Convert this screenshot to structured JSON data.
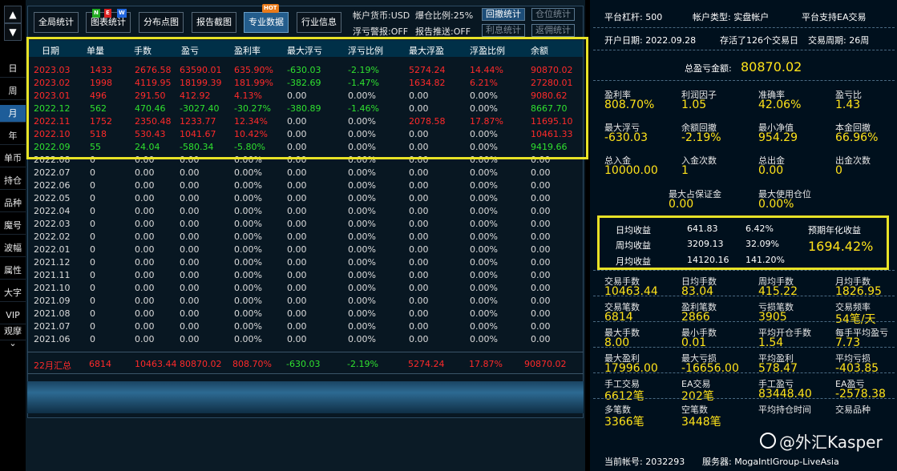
{
  "colors": {
    "up": "#ff2a2a",
    "down": "#2fe02f",
    "neutral": "#dcdcdc",
    "highlight": "#e8e226",
    "accent": "#ffe31a",
    "header_bg": "#003048"
  },
  "left": {
    "up_icon": "up-triangle-icon",
    "down_icon": "down-triangle-icon",
    "arrows": [
      "▲",
      "▼"
    ],
    "periods": [
      "日",
      "周",
      "月",
      "年"
    ],
    "period_selected": "月",
    "tabs": [
      "单币",
      "持仓",
      "品种",
      "魔号",
      "波幅",
      "属性",
      "大字",
      "VIP",
      "观摩"
    ],
    "more": "⌄"
  },
  "tabs": [
    "全局统计",
    "图表统计",
    "分布点图",
    "报告截图",
    "专业数据",
    "行业信息"
  ],
  "tab_selected": "专业数据",
  "badge_new": [
    "N",
    "E",
    "W"
  ],
  "badge_hot": "HOT",
  "info": {
    "currency": "帐户货币:USD",
    "burst": "爆仓比例:25%",
    "float_alert": "浮亏警报:OFF",
    "report_push": "报告推送:OFF"
  },
  "side_buttons": [
    "回撤统计",
    "仓位统计",
    "利息统计",
    "返佣统计"
  ],
  "table": {
    "headers": [
      "日期",
      "单量",
      "手数",
      "盈亏",
      "盈利率",
      "最大浮亏",
      "浮亏比例",
      "最大浮盈",
      "浮盈比例",
      "余额"
    ],
    "rows": [
      [
        "2023.03",
        "1433",
        "2676.58",
        "63590.01",
        "635.90%",
        "-630.03",
        "-2.19%",
        "5274.24",
        "14.44%",
        "90870.02"
      ],
      [
        "2023.02",
        "1998",
        "4119.95",
        "18199.39",
        "181.99%",
        "-382.69",
        "-1.47%",
        "1634.82",
        "6.21%",
        "27280.01"
      ],
      [
        "2023.01",
        "496",
        "291.50",
        "412.92",
        "4.13%",
        "0.00",
        "0.00%",
        "0.00",
        "0.00%",
        "9080.62"
      ],
      [
        "2022.12",
        "562",
        "470.46",
        "-3027.40",
        "-30.27%",
        "-380.89",
        "-1.46%",
        "0.00",
        "0.00%",
        "8667.70"
      ],
      [
        "2022.11",
        "1752",
        "2350.48",
        "1233.77",
        "12.34%",
        "0.00",
        "0.00%",
        "2078.58",
        "17.87%",
        "11695.10"
      ],
      [
        "2022.10",
        "518",
        "530.43",
        "1041.67",
        "10.42%",
        "0.00",
        "0.00%",
        "0.00",
        "0.00%",
        "10461.33"
      ],
      [
        "2022.09",
        "55",
        "24.04",
        "-580.34",
        "-5.80%",
        "0.00",
        "0.00%",
        "0.00",
        "0.00%",
        "9419.66"
      ],
      [
        "2022.08",
        "0",
        "0.00",
        "0.00",
        "0.00%",
        "0.00",
        "0.00%",
        "0.00",
        "0.00%",
        "0.00"
      ],
      [
        "2022.07",
        "0",
        "0.00",
        "0.00",
        "0.00%",
        "0.00",
        "0.00%",
        "0.00",
        "0.00%",
        "0.00"
      ],
      [
        "2022.06",
        "0",
        "0.00",
        "0.00",
        "0.00%",
        "0.00",
        "0.00%",
        "0.00",
        "0.00%",
        "0.00"
      ],
      [
        "2022.05",
        "0",
        "0.00",
        "0.00",
        "0.00%",
        "0.00",
        "0.00%",
        "0.00",
        "0.00%",
        "0.00"
      ],
      [
        "2022.04",
        "0",
        "0.00",
        "0.00",
        "0.00%",
        "0.00",
        "0.00%",
        "0.00",
        "0.00%",
        "0.00"
      ],
      [
        "2022.03",
        "0",
        "0.00",
        "0.00",
        "0.00%",
        "0.00",
        "0.00%",
        "0.00",
        "0.00%",
        "0.00"
      ],
      [
        "2022.02",
        "0",
        "0.00",
        "0.00",
        "0.00%",
        "0.00",
        "0.00%",
        "0.00",
        "0.00%",
        "0.00"
      ],
      [
        "2022.01",
        "0",
        "0.00",
        "0.00",
        "0.00%",
        "0.00",
        "0.00%",
        "0.00",
        "0.00%",
        "0.00"
      ],
      [
        "2021.12",
        "0",
        "0.00",
        "0.00",
        "0.00%",
        "0.00",
        "0.00%",
        "0.00",
        "0.00%",
        "0.00"
      ],
      [
        "2021.11",
        "0",
        "0.00",
        "0.00",
        "0.00%",
        "0.00",
        "0.00%",
        "0.00",
        "0.00%",
        "0.00"
      ],
      [
        "2021.10",
        "0",
        "0.00",
        "0.00",
        "0.00%",
        "0.00",
        "0.00%",
        "0.00",
        "0.00%",
        "0.00"
      ],
      [
        "2021.09",
        "0",
        "0.00",
        "0.00",
        "0.00%",
        "0.00",
        "0.00%",
        "0.00",
        "0.00%",
        "0.00"
      ],
      [
        "2021.08",
        "0",
        "0.00",
        "0.00",
        "0.00%",
        "0.00",
        "0.00%",
        "0.00",
        "0.00%",
        "0.00"
      ],
      [
        "2021.07",
        "0",
        "0.00",
        "0.00",
        "0.00%",
        "0.00",
        "0.00%",
        "0.00",
        "0.00%",
        "0.00"
      ],
      [
        "2021.06",
        "0",
        "0.00",
        "0.00",
        "0.00%",
        "0.00",
        "0.00%",
        "0.00",
        "0.00%",
        "0.00"
      ]
    ],
    "summary": [
      "22月汇总",
      "6814",
      "10463.44",
      "80870.02",
      "808.70%",
      "-630.03",
      "-2.19%",
      "5274.24",
      "17.87%",
      "90870.02"
    ]
  },
  "right": {
    "leverage": "平台杠杆: 500",
    "account_type": "帐户类型: 实盘帐户",
    "ea_support": "平台支持EA交易",
    "open_date": "开户日期: 2022.09.28",
    "survived": "存活了126个交易日",
    "trade_period": "交易周期: 26周",
    "total_pnl_label": "总盈亏金额:",
    "total_pnl": "80870.02",
    "stats": [
      {
        "label": "盈利率",
        "value": "808.70%"
      },
      {
        "label": "利润因子",
        "value": "1.05"
      },
      {
        "label": "准确率",
        "value": "42.06%"
      },
      {
        "label": "盈亏比",
        "value": "1.43"
      },
      {
        "label": "最大浮亏",
        "value": "-630.03"
      },
      {
        "label": "余额回撤",
        "value": "-2.19%"
      },
      {
        "label": "最小净值",
        "value": "954.29"
      },
      {
        "label": "本金回撤",
        "value": "66.96%"
      },
      {
        "label": "总入金",
        "value": "10000.00"
      },
      {
        "label": "入金次数",
        "value": "1"
      },
      {
        "label": "总出金",
        "value": "0.00"
      },
      {
        "label": "出金次数",
        "value": "0"
      }
    ],
    "margin": [
      {
        "label": "最大占保证金",
        "value": "0.00"
      },
      {
        "label": "最大使用仓位",
        "value": "0.00%"
      }
    ],
    "income": {
      "rows": [
        [
          "日均收益",
          "641.83",
          "6.42%"
        ],
        [
          "周均收益",
          "3209.13",
          "32.09%"
        ],
        [
          "月均收益",
          "14120.16",
          "141.20%"
        ]
      ],
      "annual_label": "预期年化收益",
      "annual_value": "1694.42%"
    },
    "stats2": [
      {
        "label": "交易手数",
        "value": "10463.44"
      },
      {
        "label": "日均手数",
        "value": "83.04"
      },
      {
        "label": "周均手数",
        "value": "415.22"
      },
      {
        "label": "月均手数",
        "value": "1826.95"
      },
      {
        "label": "交易笔数",
        "value": "6814"
      },
      {
        "label": "盈利笔数",
        "value": "2866"
      },
      {
        "label": "亏损笔数",
        "value": "3905"
      },
      {
        "label": "交易频率",
        "value": "54笔/天"
      },
      {
        "label": "最大手数",
        "value": "8.00"
      },
      {
        "label": "最小手数",
        "value": "0.01"
      },
      {
        "label": "平均开仓手数",
        "value": "1.54"
      },
      {
        "label": "每手平均盈亏",
        "value": "7.73"
      },
      {
        "label": "最大盈利",
        "value": "17996.00"
      },
      {
        "label": "最大亏损",
        "value": "-16656.00"
      },
      {
        "label": "平均盈利",
        "value": "578.47"
      },
      {
        "label": "平均亏损",
        "value": "-403.85"
      },
      {
        "label": "手工交易",
        "value": "6612笔"
      },
      {
        "label": "EA交易",
        "value": "202笔"
      },
      {
        "label": "手工盈亏",
        "value": "83448.40"
      },
      {
        "label": "EA盈亏",
        "value": "-2578.38"
      },
      {
        "label": "多笔数",
        "value": "3366笔"
      },
      {
        "label": "空笔数",
        "value": "3448笔"
      },
      {
        "label": "平均持仓时间",
        "value": ""
      },
      {
        "label": "交易品种",
        "value": ""
      }
    ],
    "account": "当前帐号: 2032293",
    "server": "服务器: MogaIntlGroup-LiveAsia",
    "watermark": "@外汇Kasper",
    "watermark_icon": "social-logo-icon"
  }
}
